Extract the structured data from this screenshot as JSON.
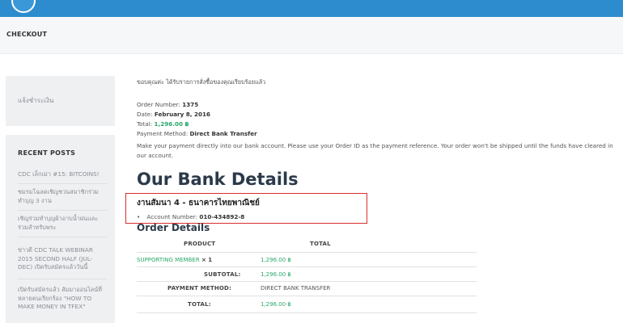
{
  "header": {
    "page_title": "CHECKOUT"
  },
  "sidebar": {
    "top_link": "แจ้งชำระเงิน",
    "recent_posts_title": "RECENT POSTS",
    "posts": [
      "CDC เล็กเม่า #15: BITCOINS!",
      "ชมรมโฉลดเชิญชวนสมาชิกร่วมทำบุญ 3 งาน",
      "เชิญร่วมทำบุญผ้าอาบน้ำฝนและร่วมสำหรับพระ",
      "ข่าวดี CDC TALK WEBINAR 2015 SECOND HALF (JUL-DEC) เปิดรับสมัครแล้ววันนี้",
      "เปิดรับสมัครแล้ว สัมมาออนไลน์ที่หลายคนเรียกร้อง \"HOW TO MAKE MONEY IN TFEX\""
    ]
  },
  "order": {
    "thank_you": "ขอบคุณค่ะ ได้รับรายการสั่งซื้อของคุณเรียบร้อยแล้ว",
    "number_label": "Order Number:",
    "number": "1375",
    "date_label": "Date:",
    "date": "February 8, 2016",
    "total_label": "Total:",
    "total": "1,296.00 ฿",
    "payment_label": "Payment Method:",
    "payment": "Direct Bank Transfer",
    "instructions": "Make your payment directly into our bank account. Please use your Order ID as the payment reference. Your order won't be shipped until the funds have cleared in our account."
  },
  "bank": {
    "heading": "Our Bank Details",
    "name": "งานสัมนา 4 - ธนาคารไทยพาณิชย์",
    "account_label": "Account Number:",
    "account_number": "010-434892-8"
  },
  "order_details": {
    "heading": "Order Details",
    "col_product": "PRODUCT",
    "col_total": "TOTAL",
    "item_name": "SUPPORTING MEMBER",
    "item_qty": "× 1",
    "item_total": "1,296.00 ฿",
    "subtotal_label": "SUBTOTAL:",
    "subtotal": "1,296.00 ฿",
    "payment_label": "PAYMENT METHOD:",
    "payment": "DIRECT BANK TRANSFER",
    "total_label": "TOTAL:",
    "total": "1,296.00 ฿"
  },
  "colors": {
    "header_blue": "#2d8ccd",
    "accent_green": "#2aa86a",
    "highlight_red": "#d92e2e"
  }
}
